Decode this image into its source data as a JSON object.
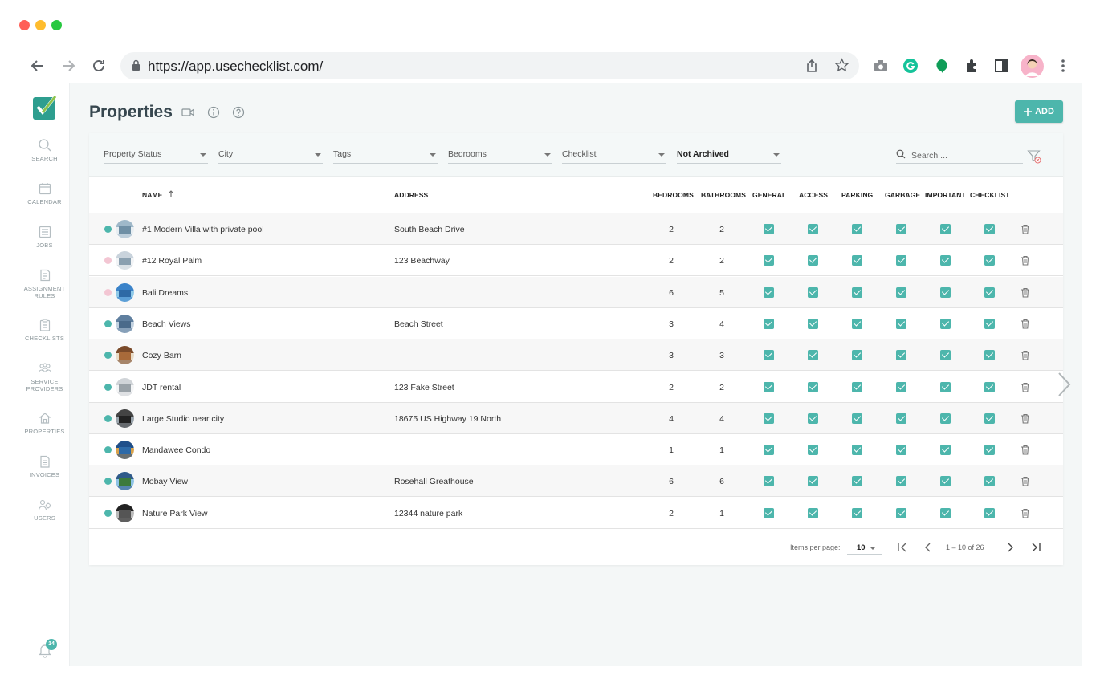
{
  "browser": {
    "url": "https://app.usechecklist.com/",
    "traffic_colors": [
      "#ff5f57",
      "#febc2e",
      "#28c840"
    ]
  },
  "sidebar": {
    "items": [
      {
        "label": "SEARCH",
        "icon": "search-icon"
      },
      {
        "label": "CALENDAR",
        "icon": "calendar-icon"
      },
      {
        "label": "JOBS",
        "icon": "jobs-icon"
      },
      {
        "label": "ASSIGNMENT",
        "label2": "RULES",
        "icon": "assignment-rules-icon"
      },
      {
        "label": "CHECKLISTS",
        "icon": "clipboard-icon"
      },
      {
        "label": "SERVICE",
        "label2": "PROVIDERS",
        "icon": "service-providers-icon"
      },
      {
        "label": "PROPERTIES",
        "icon": "home-icon"
      },
      {
        "label": "INVOICES",
        "icon": "invoice-icon"
      },
      {
        "label": "USERS",
        "icon": "users-icon"
      }
    ],
    "notification_count": "14"
  },
  "header": {
    "title": "Properties",
    "add_label": "ADD"
  },
  "filters": {
    "property_status": "Property Status",
    "city": "City",
    "tags": "Tags",
    "bedrooms": "Bedrooms",
    "checklist": "Checklist",
    "archive": "Not Archived",
    "search_placeholder": "Search ..."
  },
  "table": {
    "columns": {
      "name": "NAME",
      "address": "ADDRESS",
      "bedrooms": "BEDROOMS",
      "bathrooms": "BATHROOMS",
      "general": "GENERAL",
      "access": "ACCESS",
      "parking": "PARKING",
      "garbage": "GARBAGE",
      "important": "IMPORTANT",
      "checklist": "CHECKLIST"
    },
    "rows": [
      {
        "name": "#1 Modern Villa with private pool",
        "address": "South Beach Drive",
        "bedrooms": "2",
        "bathrooms": "2",
        "status": "active"
      },
      {
        "name": "#12 Royal Palm",
        "address": "123 Beachway",
        "bedrooms": "2",
        "bathrooms": "2",
        "status": "inactive"
      },
      {
        "name": "Bali Dreams",
        "address": "",
        "bedrooms": "6",
        "bathrooms": "5",
        "status": "inactive"
      },
      {
        "name": "Beach Views",
        "address": "Beach Street",
        "bedrooms": "3",
        "bathrooms": "4",
        "status": "active"
      },
      {
        "name": "Cozy Barn",
        "address": "",
        "bedrooms": "3",
        "bathrooms": "3",
        "status": "active"
      },
      {
        "name": "JDT rental",
        "address": "123 Fake Street",
        "bedrooms": "2",
        "bathrooms": "2",
        "status": "active"
      },
      {
        "name": "Large Studio near city",
        "address": "18675 US Highway 19 North",
        "bedrooms": "4",
        "bathrooms": "4",
        "status": "active"
      },
      {
        "name": "Mandawee Condo",
        "address": "",
        "bedrooms": "1",
        "bathrooms": "1",
        "status": "active"
      },
      {
        "name": "Mobay View",
        "address": "Rosehall Greathouse",
        "bedrooms": "6",
        "bathrooms": "6",
        "status": "active"
      },
      {
        "name": "Nature Park View",
        "address": "12344 nature park",
        "bedrooms": "2",
        "bathrooms": "1",
        "status": "active"
      }
    ]
  },
  "paginator": {
    "items_per_page_label": "Items per page:",
    "page_size": "10",
    "range": "1 – 10 of 26"
  },
  "colors": {
    "accent": "#4db6ac",
    "status_active": "#4db6ac",
    "status_inactive": "#f3c6d3"
  }
}
